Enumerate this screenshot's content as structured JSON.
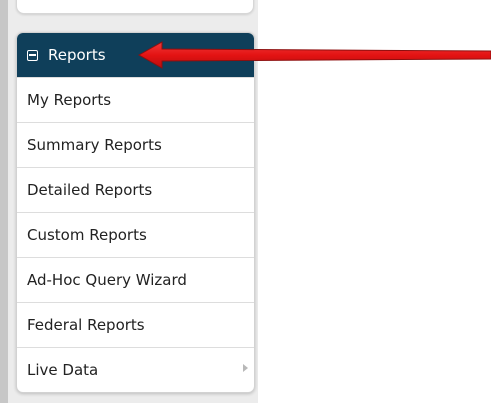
{
  "menu": {
    "header_label": "Reports",
    "items": [
      {
        "label": "My Reports"
      },
      {
        "label": "Summary Reports"
      },
      {
        "label": "Detailed Reports"
      },
      {
        "label": "Custom Reports"
      },
      {
        "label": "Ad-Hoc Query Wizard"
      },
      {
        "label": "Federal Reports"
      },
      {
        "label": "Live Data"
      }
    ]
  },
  "colors": {
    "header_bg": "#0f3f5a",
    "arrow": "#e41313"
  },
  "icons": {
    "header": "collapse-icon",
    "submenu": "chevron-right-icon",
    "annotation": "red-arrow"
  }
}
